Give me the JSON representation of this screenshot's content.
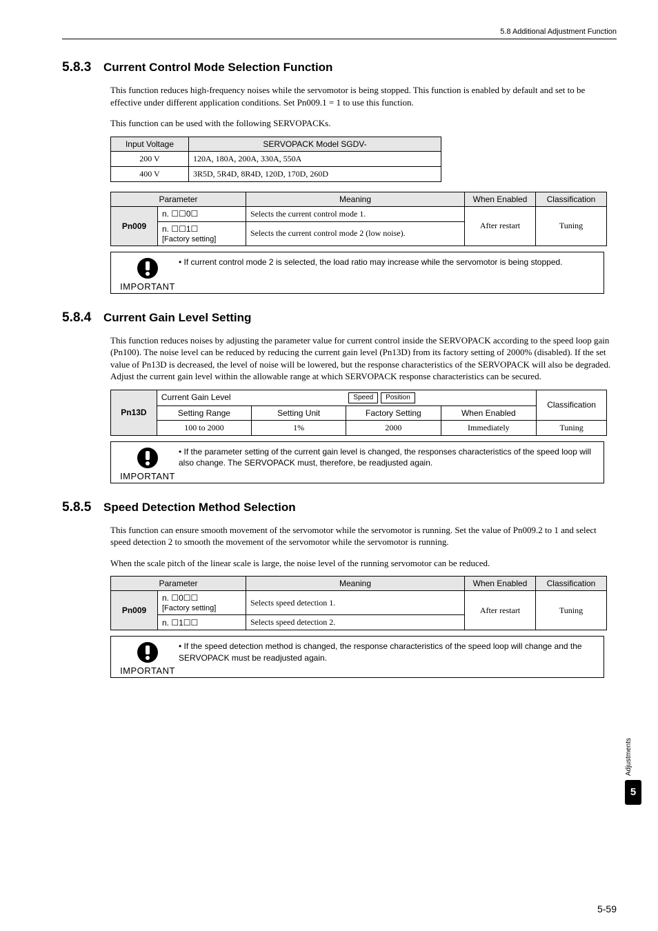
{
  "header": {
    "breadcrumb": "5.8  Additional Adjustment Function"
  },
  "s583": {
    "num": "5.8.3",
    "title": "Current Control Mode Selection Function",
    "p1": "This function reduces high-frequency noises while the servomotor is being stopped. This function is enabled by default and set to be effective under different application conditions. Set Pn009.1 = 1 to use this function.",
    "p2": "This function can be used with the following SERVOPACKs.",
    "t1": {
      "h1": "Input Voltage",
      "h2": "SERVOPACK Model SGDV-",
      "r1c1": "200 V",
      "r1c2": "120A, 180A, 200A, 330A, 550A",
      "r2c1": "400 V",
      "r2c2": "3R5D, 5R4D, 8R4D, 120D, 170D, 260D"
    },
    "t2": {
      "h1": "Parameter",
      "h2": "Meaning",
      "h3": "When Enabled",
      "h4": "Classification",
      "pn": "Pn009",
      "r1a": "n. ☐☐0☐",
      "r1b": "Selects the current control mode 1.",
      "r2a": "n. ☐☐1☐",
      "r2a_sub": "[Factory setting]",
      "r2b": "Selects the current control mode 2 (low noise).",
      "when": "After restart",
      "cls": "Tuning"
    },
    "call": "If current control mode 2 is selected, the load ratio may increase while the servomotor is being stopped.",
    "imp": "IMPORTANT"
  },
  "s584": {
    "num": "5.8.4",
    "title": "Current Gain Level Setting",
    "p1": "This function reduces noises by adjusting the parameter value for current control inside the SERVOPACK according to the speed loop gain (Pn100). The noise level can be reduced by reducing the current gain level (Pn13D) from its factory setting of 2000% (disabled). If the set value of Pn13D is decreased, the level of noise will be lowered, but the response characteristics of the SERVOPACK will also be degraded. Adjust the current gain level within the allowable range at which SERVOPACK response characteristics can be secured.",
    "t3": {
      "pn": "Pn13D",
      "name": "Current Gain Level",
      "tag1": "Speed",
      "tag2": "Position",
      "hcls": "Classification",
      "h1": "Setting Range",
      "h2": "Setting Unit",
      "h3": "Factory Setting",
      "h4": "When Enabled",
      "r1": "100 to 2000",
      "r2": "1%",
      "r3": "2000",
      "r4": "Immediately",
      "cls": "Tuning"
    },
    "call": "If the parameter setting of the current gain level is changed, the responses characteristics of the speed loop will also change. The SERVOPACK must, therefore, be readjusted again.",
    "imp": "IMPORTANT"
  },
  "s585": {
    "num": "5.8.5",
    "title": "Speed Detection Method Selection",
    "p1": "This function can ensure smooth movement of the servomotor while the servomotor is running. Set the value of Pn009.2 to 1 and select speed detection 2 to smooth the movement of the servomotor while the servomotor is running.",
    "p2": "When the scale pitch of the linear scale is large, the noise level of the running servomotor can be reduced.",
    "t4": {
      "h1": "Parameter",
      "h2": "Meaning",
      "h3": "When Enabled",
      "h4": "Classification",
      "pn": "Pn009",
      "r1a": "n. ☐0☐☐",
      "r1a_sub": "[Factory setting]",
      "r1b": "Selects speed detection 1.",
      "r2a": "n. ☐1☐☐",
      "r2b": "Selects speed detection 2.",
      "when": "After restart",
      "cls": "Tuning"
    },
    "call": "If the speed detection method is changed, the response characteristics of the speed loop will change and the SERVOPACK must be readjusted again.",
    "imp": "IMPORTANT"
  },
  "side": {
    "label": "Adjustments",
    "num": "5"
  },
  "pagenum": "5-59"
}
